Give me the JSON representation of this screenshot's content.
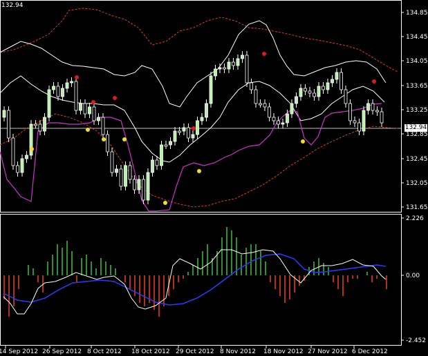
{
  "header": {
    "symbol_price": "132.94"
  },
  "price_panel": {
    "current_price_label": "132.94",
    "y_ticks": [
      "134.85",
      "134.45",
      "134.05",
      "133.65",
      "133.25",
      "132.85",
      "132.45",
      "132.05",
      "131.65"
    ],
    "last_price": 132.94,
    "y_range": [
      131.55,
      134.95
    ]
  },
  "oscillator_panel": {
    "y_ticks": [
      "2.226",
      "0.00",
      "-2.452"
    ],
    "y_range": [
      -2.452,
      2.226
    ]
  },
  "x_axis": {
    "labels": [
      "14 Sep 2012",
      "26 Sep 2012",
      "8 Oct 2012",
      "18 Oct 2012",
      "29 Oct 2012",
      "8 Nov 2012",
      "18 Nov 2012",
      "27 Nov 2012",
      "6 Dec 2012"
    ]
  },
  "colors": {
    "background": "#000000",
    "axis": "#ffffff",
    "candle_bull": "#ffffff",
    "candle_bear": "#ffffff",
    "candle_body_fill": "#b8f0a8",
    "bands_outer": "#e03c1c",
    "bands_inner": "#ffffff",
    "magenta_line": "#cc33cc",
    "dot_red": "#e01818",
    "dot_yellow": "#f0e020",
    "hist_up": "#3cb43c",
    "hist_down": "#e03c1c",
    "signal_blue": "#2a3cff",
    "signal_white": "#fffff0"
  }
}
